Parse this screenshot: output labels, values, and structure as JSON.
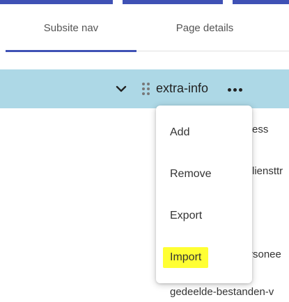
{
  "tabs": [
    {
      "label": "Subsite nav",
      "active": true
    },
    {
      "label": "Page details",
      "active": false
    }
  ],
  "tree": {
    "partial_item_above": "",
    "selected_node": "extra-info",
    "background_items": [
      "ess",
      "liensttr",
      "rsonee",
      "gedeelde-bestanden-v"
    ]
  },
  "context_menu": {
    "items": [
      "Add",
      "Remove",
      "Export",
      "Import"
    ],
    "highlighted_item": "Import"
  },
  "colors": {
    "accent": "#3f51b5",
    "selected_row": "#add8e6",
    "highlight": "#ffff33"
  },
  "icons": {
    "expand": "chevron-down-icon",
    "drag": "drag-handle-icon",
    "more": "more-horizontal-icon"
  }
}
